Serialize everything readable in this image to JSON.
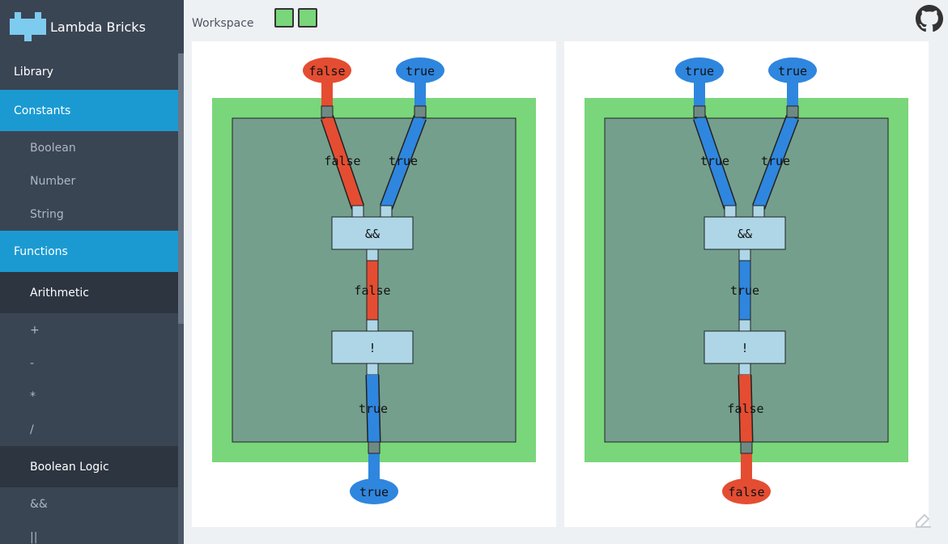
{
  "app": {
    "name": "Lambda Bricks"
  },
  "sidebar": {
    "library": "Library",
    "constants": {
      "label": "Constants",
      "items": [
        "Boolean",
        "Number",
        "String"
      ]
    },
    "functions": {
      "label": "Functions"
    },
    "arithmetic": {
      "label": "Arithmetic",
      "items": [
        "+",
        "-",
        "*",
        "/"
      ]
    },
    "boolean_logic": {
      "label": "Boolean Logic",
      "items": [
        "&&",
        "||"
      ]
    }
  },
  "topbar": {
    "workspace_label": "Workspace"
  },
  "icons": {
    "github": "github-icon",
    "edit": "edit-corner-icon",
    "logo": "brick-logo-icon"
  },
  "colors": {
    "false": "#e44d32",
    "true": "#2f86de",
    "brick_outer": "#7ad67a",
    "brick_inner": "#749f8d",
    "func_box": "#aed6e6",
    "active_menu": "#1b9ad2"
  },
  "workspace": {
    "panels": [
      {
        "input_left": "false",
        "input_right": "true",
        "wire_left": "false",
        "wire_right": "true",
        "and_label": "&&",
        "and_output": "false",
        "not_label": "!",
        "not_output": "true",
        "output": "true"
      },
      {
        "input_left": "true",
        "input_right": "true",
        "wire_left": "true",
        "wire_right": "true",
        "and_label": "&&",
        "and_output": "true",
        "not_label": "!",
        "not_output": "false",
        "output": "false"
      }
    ]
  }
}
